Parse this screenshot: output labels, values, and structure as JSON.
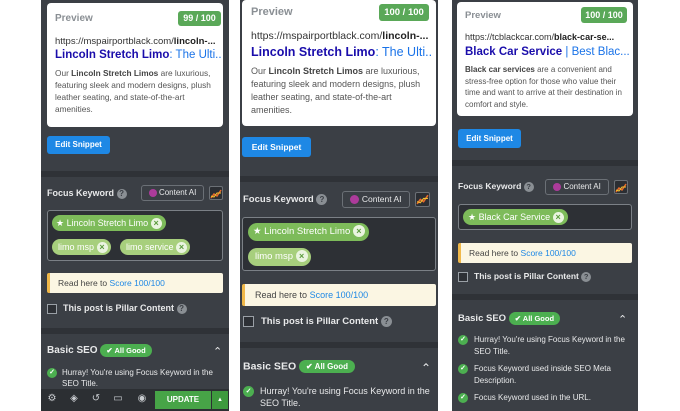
{
  "common": {
    "preview_label": "Preview",
    "edit_snippet": "Edit Snippet",
    "focus_keyword_label": "Focus Keyword",
    "help_glyph": "?",
    "content_ai": "Content AI",
    "remove_glyph": "×",
    "star_glyph": "★",
    "notice_prefix": "Read here to",
    "notice_link": "Score 100/100",
    "pillar": "This post is Pillar Content",
    "basic_seo": "Basic SEO",
    "all_good": "✔ All Good",
    "chevron": "⌃",
    "check_glyph": "✓",
    "accent_green": "#5aa858",
    "link_blue": "#1a0dab"
  },
  "panel1": {
    "score": "99 / 100",
    "url_plain": "https://mspairportblack.com/",
    "url_bold": "lincoln-...",
    "title_bold": "Lincoln Stretch Limo",
    "title_rest": ": The Ulti...",
    "desc": {
      "p1": "Our ",
      "b1": "Lincoln Stretch Limos",
      "p2": " are luxurious, featuring sleek and modern designs, plush leather seating, and state-of-the-art amenities."
    },
    "keywords": [
      "Lincoln Stretch Limo",
      "limo msp",
      "limo service"
    ],
    "check_items": [
      "Hurray! You're using Focus Keyword in the SEO Title."
    ],
    "bottom_bar": {
      "update": "UPDATE",
      "arrow": "▲",
      "tools": [
        "⚙",
        "◈",
        "↺",
        "▭",
        "◉"
      ]
    }
  },
  "panel2": {
    "score": "100 / 100",
    "url_plain": "https://mspairportblack.com/",
    "url_bold": "lincoln-...",
    "title_bold": "Lincoln Stretch Limo",
    "title_rest": ": The Ulti...",
    "desc": {
      "p1": "Our ",
      "b1": "Lincoln Stretch Limos",
      "p2": " are luxurious, featuring sleek and modern designs, plush leather seating, and state-of-the-art amenities."
    },
    "keywords": [
      "Lincoln Stretch Limo",
      "limo msp"
    ],
    "check_items": [
      "Hurray! You're using Focus Keyword in the SEO Title."
    ]
  },
  "panel3": {
    "score": "100 / 100",
    "url_plain": "https://tcblackcar.com/",
    "url_bold": "black-car-se...",
    "title_bold": "Black Car Service",
    "title_rest": " | Best Blac...",
    "desc": {
      "b1": "Black car services",
      "p2": " are a convenient and stress-free option for those who value their time and want to arrive at their destination in comfort and style."
    },
    "keywords": [
      "Black Car Service"
    ],
    "check_items": [
      "Hurray! You're using Focus Keyword in the SEO Title.",
      "Focus Keyword used inside SEO Meta Description.",
      "Focus Keyword used in the URL."
    ]
  }
}
